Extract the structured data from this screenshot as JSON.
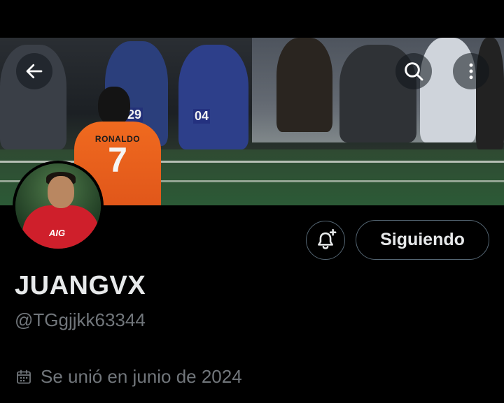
{
  "header": {
    "back_icon": "arrow-left-icon",
    "search_icon": "search-icon",
    "more_icon": "more-vertical-icon"
  },
  "banner": {
    "player_name": "RONALDO",
    "player_number": "7",
    "badge_1": "029",
    "badge_2": "04"
  },
  "avatar": {
    "shirt_text": "AIG"
  },
  "actions": {
    "notify_icon": "bell-plus-icon",
    "follow_label": "Siguiendo"
  },
  "profile": {
    "display_name": "JUANGVX",
    "handle": "@TGgjjkk63344",
    "joined_icon": "calendar-icon",
    "joined_text": "Se unió en junio de 2024"
  },
  "colors": {
    "background": "#000000",
    "text_primary": "#e7e9ea",
    "text_secondary": "#71767b",
    "border": "#536471"
  }
}
